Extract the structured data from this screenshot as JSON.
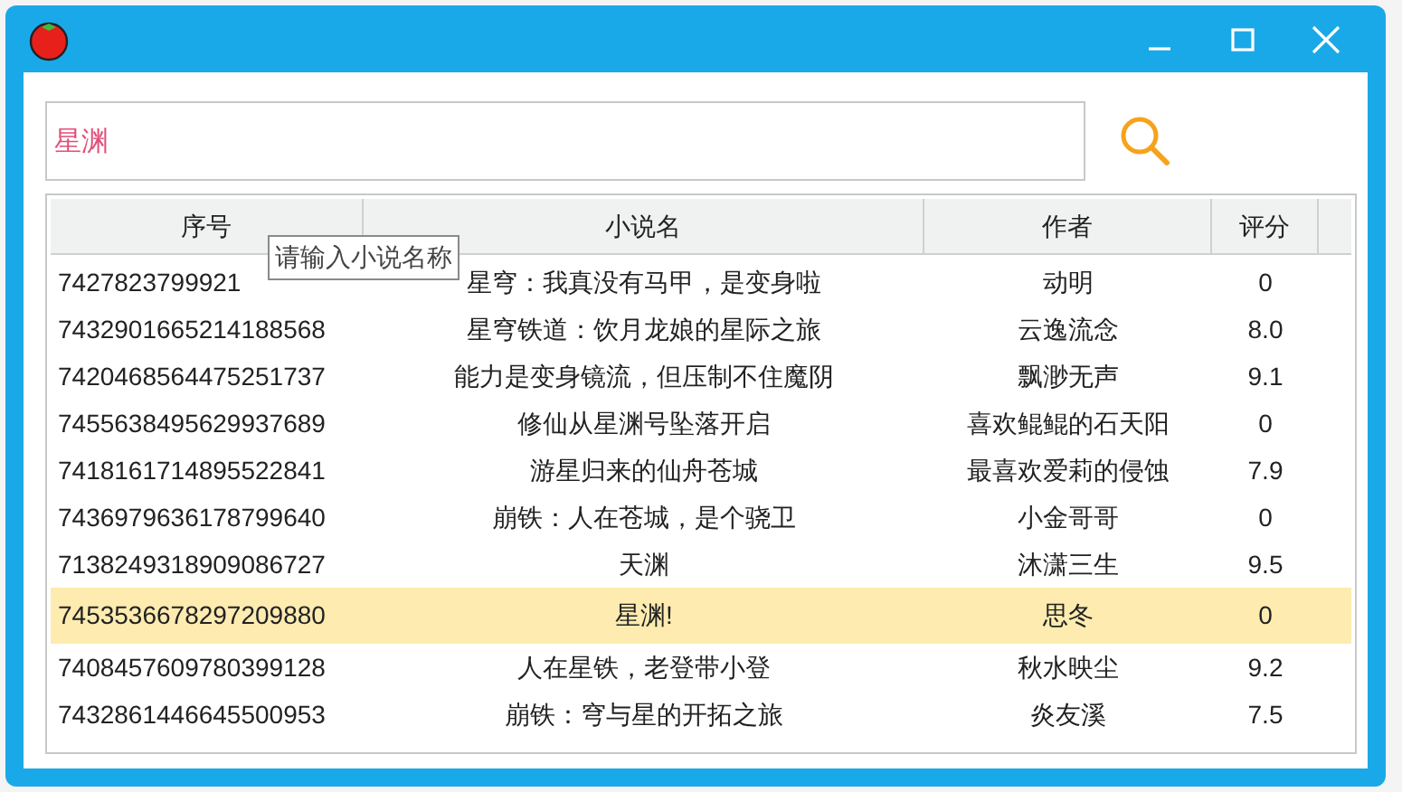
{
  "search": {
    "value": "星渊",
    "tooltip": "请输入小说名称"
  },
  "table": {
    "columns": [
      "序号",
      "小说名",
      "作者",
      "评分"
    ],
    "rows": [
      {
        "id": "7427823799921",
        "title": "星穹：我真没有马甲，是变身啦",
        "author": "动明",
        "score": "0",
        "selected": false
      },
      {
        "id": "7432901665214188568",
        "title": "星穹铁道：饮月龙娘的星际之旅",
        "author": "云逸流念",
        "score": "8.0",
        "selected": false
      },
      {
        "id": "7420468564475251737",
        "title": "能力是变身镜流，但压制不住魔阴",
        "author": "飘渺无声",
        "score": "9.1",
        "selected": false
      },
      {
        "id": "7455638495629937689",
        "title": "修仙从星渊号坠落开启",
        "author": "喜欢鲲鲲的石天阳",
        "score": "0",
        "selected": false
      },
      {
        "id": "7418161714895522841",
        "title": "游星归来的仙舟苍城",
        "author": "最喜欢爱莉的侵蚀",
        "score": "7.9",
        "selected": false
      },
      {
        "id": "7436979636178799640",
        "title": "崩铁：人在苍城，是个骁卫",
        "author": "小金哥哥",
        "score": "0",
        "selected": false
      },
      {
        "id": "7138249318909086727",
        "title": "天渊",
        "author": "沐潇三生",
        "score": "9.5",
        "selected": false
      },
      {
        "id": "7453536678297209880",
        "title": "星渊!",
        "author": "思冬",
        "score": "0",
        "selected": true
      },
      {
        "id": "7408457609780399128",
        "title": "人在星铁，老登带小登",
        "author": "秋水映尘",
        "score": "9.2",
        "selected": false
      },
      {
        "id": "7432861446645500953",
        "title": "崩铁：穹与星的开拓之旅",
        "author": "炎友溪",
        "score": "7.5",
        "selected": false
      }
    ]
  }
}
